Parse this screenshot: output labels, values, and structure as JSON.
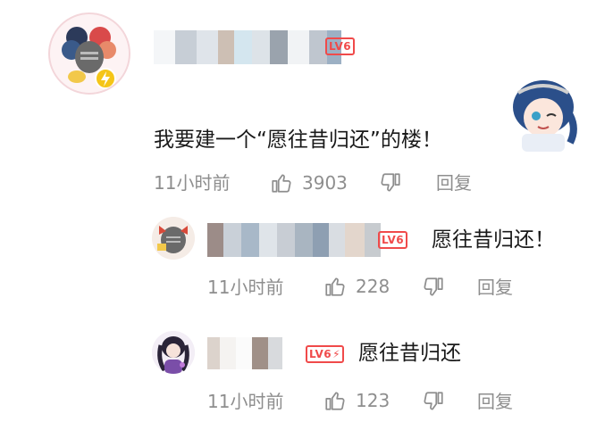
{
  "main_comment": {
    "level": "LV6",
    "text": "我要建一个“愿往昔归还”的楼！",
    "time": "11小时前",
    "like_count": "3903",
    "reply_label": "回复"
  },
  "replies": [
    {
      "level": "LV6",
      "text": "愿往昔归还！",
      "time": "11小时前",
      "like_count": "228",
      "reply_label": "回复"
    },
    {
      "level": "LV6",
      "text": "愿往昔归还",
      "time": "11小时前",
      "like_count": "123",
      "reply_label": "回复"
    }
  ],
  "colors": {
    "level_badge": "#f04a4a",
    "meta_text": "#8e8e8e",
    "body_text": "#1a1a1a"
  }
}
